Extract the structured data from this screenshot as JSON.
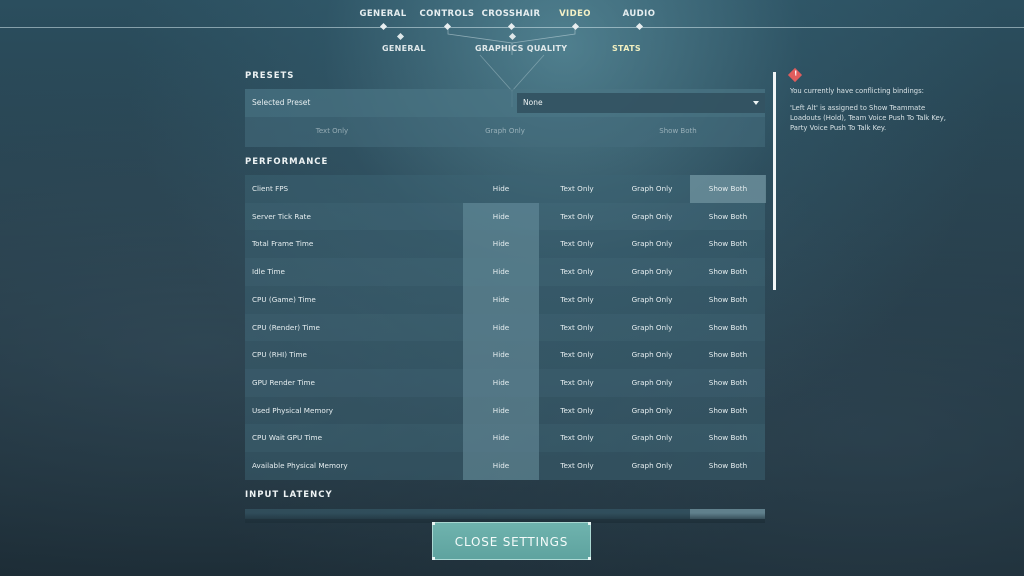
{
  "top_tabs": [
    {
      "label": "GENERAL",
      "active": false
    },
    {
      "label": "CONTROLS",
      "active": false
    },
    {
      "label": "CROSSHAIR",
      "active": false
    },
    {
      "label": "VIDEO",
      "active": true
    },
    {
      "label": "AUDIO",
      "active": false
    }
  ],
  "sub_tabs": [
    {
      "label": "GENERAL",
      "active": false
    },
    {
      "label": "GRAPHICS QUALITY",
      "active": false
    },
    {
      "label": "STATS",
      "active": true
    }
  ],
  "presets": {
    "title": "PRESETS",
    "selected_label": "Selected Preset",
    "selected_value": "None",
    "options": [
      "Text Only",
      "Graph Only",
      "Show Both"
    ]
  },
  "performance": {
    "title": "PERFORMANCE",
    "option_labels": [
      "Hide",
      "Text Only",
      "Graph Only",
      "Show Both"
    ],
    "rows": [
      {
        "label": "Client FPS",
        "selected": "Show Both"
      },
      {
        "label": "Server Tick Rate",
        "selected": "Hide"
      },
      {
        "label": "Total Frame Time",
        "selected": "Hide"
      },
      {
        "label": "Idle Time",
        "selected": "Hide"
      },
      {
        "label": "CPU (Game) Time",
        "selected": "Hide"
      },
      {
        "label": "CPU (Render) Time",
        "selected": "Hide"
      },
      {
        "label": "CPU (RHI) Time",
        "selected": "Hide"
      },
      {
        "label": "GPU Render Time",
        "selected": "Hide"
      },
      {
        "label": "Used Physical Memory",
        "selected": "Hide"
      },
      {
        "label": "CPU Wait GPU Time",
        "selected": "Hide"
      },
      {
        "label": "Available Physical Memory",
        "selected": "Hide"
      }
    ]
  },
  "input_latency": {
    "title": "INPUT LATENCY"
  },
  "warning": {
    "icon": "alert-diamond-icon",
    "color": "#e05d5d",
    "title": "You currently have conflicting bindings:",
    "body": "'Left Alt' is assigned to Show Teammate Loadouts (Hold), Team Voice Push To Talk Key, Party Voice Push To Talk Key."
  },
  "close_button": {
    "label": "CLOSE SETTINGS",
    "color": "#6fb3ae"
  }
}
